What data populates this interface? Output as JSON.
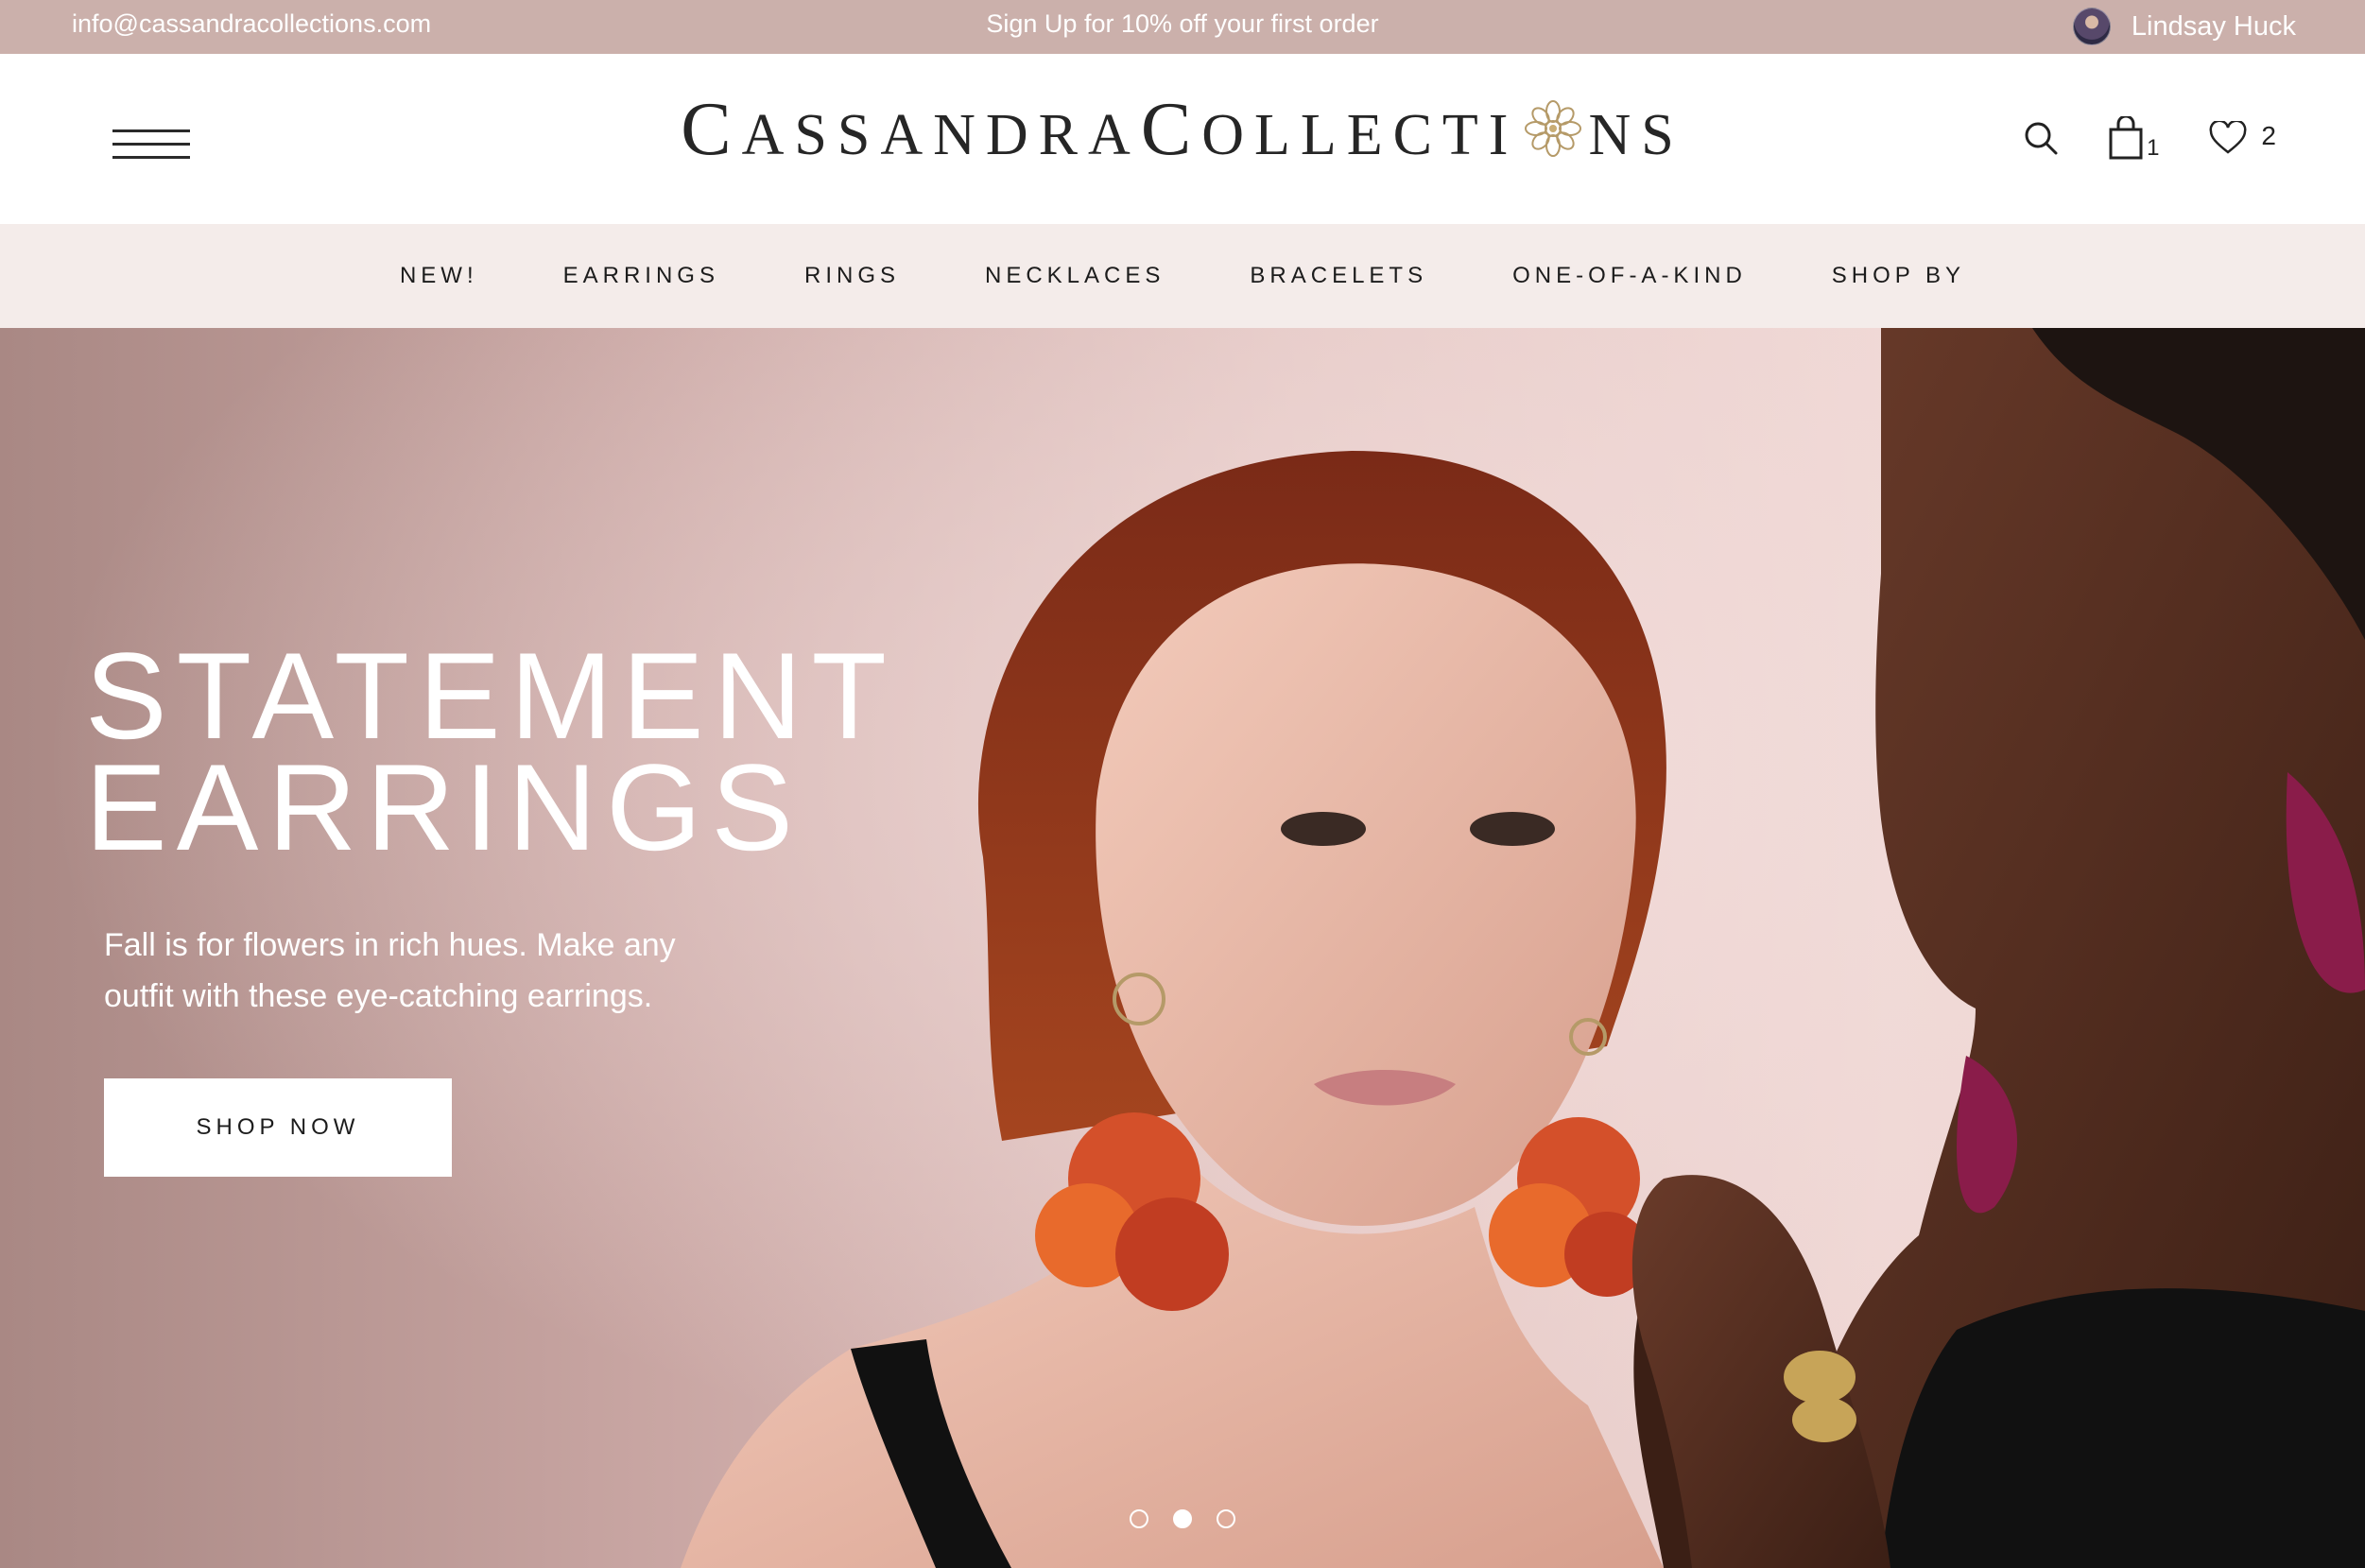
{
  "topbar": {
    "email": "info@cassandracollections.com",
    "promo": "Sign Up for 10% off your first order",
    "user_name": "Lindsay Huck"
  },
  "header": {
    "logo_parts": [
      "C",
      "ASSANDRA",
      "C",
      "OLLECTI",
      "NS"
    ],
    "cart_count": "1",
    "wishlist_count": "2",
    "icons": [
      "menu-icon",
      "search-icon",
      "shopping-bag-icon",
      "heart-icon",
      "flower-logo-icon"
    ]
  },
  "nav": {
    "items": [
      "NEW!",
      "EARRINGS",
      "RINGS",
      "NECKLACES",
      "BRACELETS",
      "ONE-OF-A-KIND",
      "SHOP BY"
    ]
  },
  "hero": {
    "title_line1": "STATEMENT",
    "title_line2": "EARRINGS",
    "subtitle_line1": "Fall is for flowers in rich hues. Make any",
    "subtitle_line2": "outfit with these eye-catching earrings.",
    "cta_label": "SHOP NOW",
    "slides": 3,
    "active_slide": 2
  },
  "colors": {
    "topbar_bg": "#cbb0ab",
    "nav_bg": "#f4ecea",
    "hero_bg": "#d9b8b5",
    "text_dark": "#1c1c1c"
  }
}
